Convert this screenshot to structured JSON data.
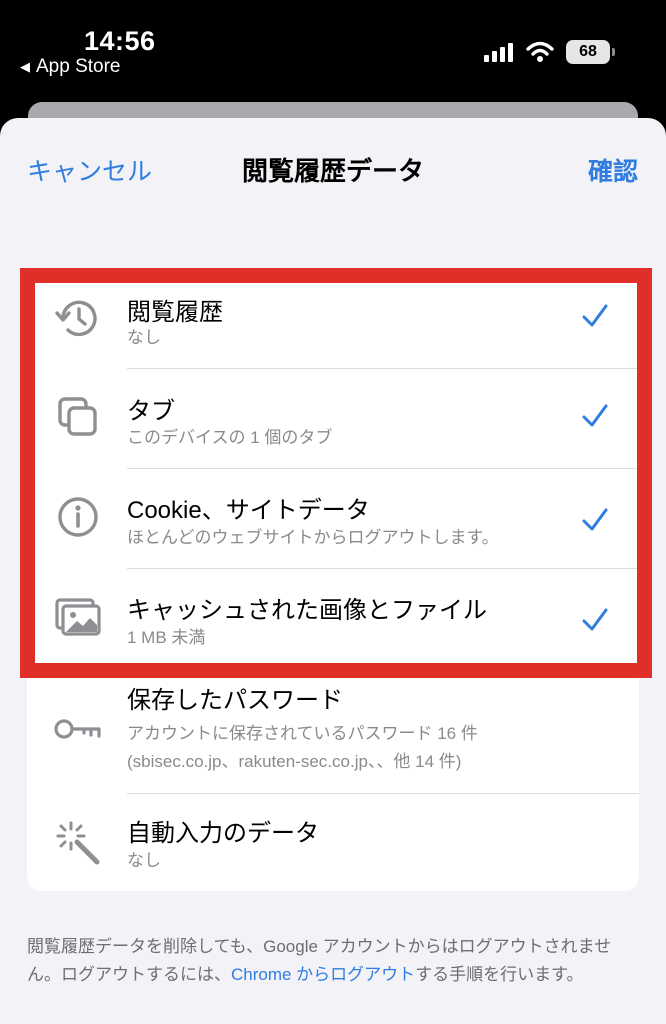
{
  "status_bar": {
    "time": "14:56",
    "back_app": "App Store",
    "battery": "68"
  },
  "nav": {
    "cancel": "キャンセル",
    "title": "閲覧履歴データ",
    "confirm": "確認"
  },
  "items": [
    {
      "icon": "history-icon",
      "title": "閲覧履歴",
      "subtitle": "なし",
      "checked": true
    },
    {
      "icon": "tabs-icon",
      "title": "タブ",
      "subtitle": "このデバイスの 1 個のタブ",
      "checked": true
    },
    {
      "icon": "info-icon",
      "title": "Cookie、サイトデータ",
      "subtitle": "ほとんどのウェブサイトからログアウトします。",
      "checked": true
    },
    {
      "icon": "images-icon",
      "title": "キャッシュされた画像とファイル",
      "subtitle": "1 MB 未満",
      "checked": true
    },
    {
      "icon": "key-icon",
      "title": "保存したパスワード",
      "subtitle": "アカウントに保存されているパスワード 16 件",
      "subtitle2": "(sbisec.co.jp、rakuten-sec.co.jp、、他 14 件)",
      "checked": false
    },
    {
      "icon": "magic-wand-icon",
      "title": "自動入力のデータ",
      "subtitle": "なし",
      "checked": false
    }
  ],
  "footer": {
    "text_before": "閲覧履歴データを削除しても、Google アカウントからはログアウトされません。ログアウトするには、",
    "link": "Chrome からログアウト",
    "text_after": "する手順を行います。"
  },
  "colors": {
    "accent": "#2f7de1",
    "highlight": "#e02f28",
    "icon": "#8e8e93"
  }
}
